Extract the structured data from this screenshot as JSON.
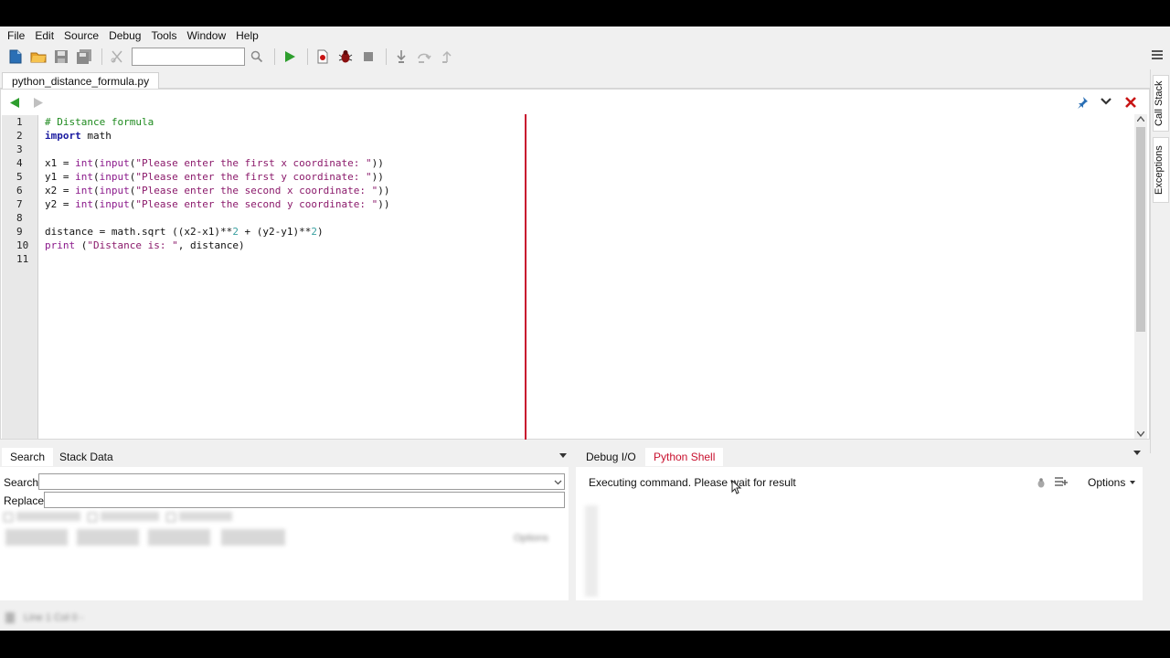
{
  "menubar": {
    "items": [
      "File",
      "Edit",
      "Source",
      "Debug",
      "Tools",
      "Window",
      "Help"
    ]
  },
  "toolbar": {
    "icons": [
      "new-file-icon",
      "open-folder-icon",
      "save-icon",
      "save-all-icon",
      "cut-icon",
      "search-icon",
      "run-icon",
      "run-to-cursor-icon",
      "debug-bug-icon",
      "stop-icon",
      "step-into-icon",
      "step-over-icon",
      "step-out-icon"
    ],
    "search_value": ""
  },
  "file_tab": {
    "label": "python_distance_formula.py"
  },
  "editor": {
    "line_numbers": [
      "1",
      "2",
      "3",
      "4",
      "5",
      "6",
      "7",
      "8",
      "9",
      "10",
      "11"
    ],
    "lines": [
      [
        {
          "t": "# Distance formula",
          "c": "cm"
        }
      ],
      [
        {
          "t": "import",
          "c": "kw"
        },
        {
          "t": " math",
          "c": ""
        }
      ],
      [],
      [
        {
          "t": "x1 = ",
          "c": ""
        },
        {
          "t": "int",
          "c": "bi"
        },
        {
          "t": "(",
          "c": ""
        },
        {
          "t": "input",
          "c": "bi"
        },
        {
          "t": "(",
          "c": ""
        },
        {
          "t": "\"Please enter the first x coordinate: \"",
          "c": "st"
        },
        {
          "t": "))",
          "c": ""
        }
      ],
      [
        {
          "t": "y1 = ",
          "c": ""
        },
        {
          "t": "int",
          "c": "bi"
        },
        {
          "t": "(",
          "c": ""
        },
        {
          "t": "input",
          "c": "bi"
        },
        {
          "t": "(",
          "c": ""
        },
        {
          "t": "\"Please enter the first y coordinate: \"",
          "c": "st"
        },
        {
          "t": "))",
          "c": ""
        }
      ],
      [
        {
          "t": "x2 = ",
          "c": ""
        },
        {
          "t": "int",
          "c": "bi"
        },
        {
          "t": "(",
          "c": ""
        },
        {
          "t": "input",
          "c": "bi"
        },
        {
          "t": "(",
          "c": ""
        },
        {
          "t": "\"Please enter the second x coordinate: \"",
          "c": "st"
        },
        {
          "t": "))",
          "c": ""
        }
      ],
      [
        {
          "t": "y2 = ",
          "c": ""
        },
        {
          "t": "int",
          "c": "bi"
        },
        {
          "t": "(",
          "c": ""
        },
        {
          "t": "input",
          "c": "bi"
        },
        {
          "t": "(",
          "c": ""
        },
        {
          "t": "\"Please enter the second y coordinate: \"",
          "c": "st"
        },
        {
          "t": "))",
          "c": ""
        }
      ],
      [],
      [
        {
          "t": "distance = math.sqrt ((x2-x1)**",
          "c": ""
        },
        {
          "t": "2",
          "c": "nm"
        },
        {
          "t": " + (y2-y1)**",
          "c": ""
        },
        {
          "t": "2",
          "c": "nm"
        },
        {
          "t": ")",
          "c": ""
        }
      ],
      [
        {
          "t": "print",
          "c": "bi"
        },
        {
          "t": " (",
          "c": ""
        },
        {
          "t": "\"Distance is: \"",
          "c": "st"
        },
        {
          "t": ", distance)",
          "c": ""
        }
      ],
      []
    ]
  },
  "right_sidebar": {
    "tabs": [
      "Call Stack",
      "Exceptions"
    ]
  },
  "bottom_left": {
    "tabs": [
      "Search",
      "Stack Data"
    ],
    "active_tab": "Search",
    "search_label": "Search:",
    "replace_label": "Replace:",
    "search_value": "",
    "replace_value": "",
    "options_label": "Options"
  },
  "bottom_right": {
    "tabs": [
      "Debug I/O",
      "Python Shell"
    ],
    "active_tab": "Python Shell",
    "status_message": "Executing command.  Please wait for result",
    "options_label": "Options"
  },
  "status_bar": {
    "text": "Line 1 Col 0 -"
  },
  "colors": {
    "accent_tab": "#c8102e",
    "margin_line": "#c8102e",
    "run_green": "#2e9e2e",
    "close_red": "#c81414"
  }
}
